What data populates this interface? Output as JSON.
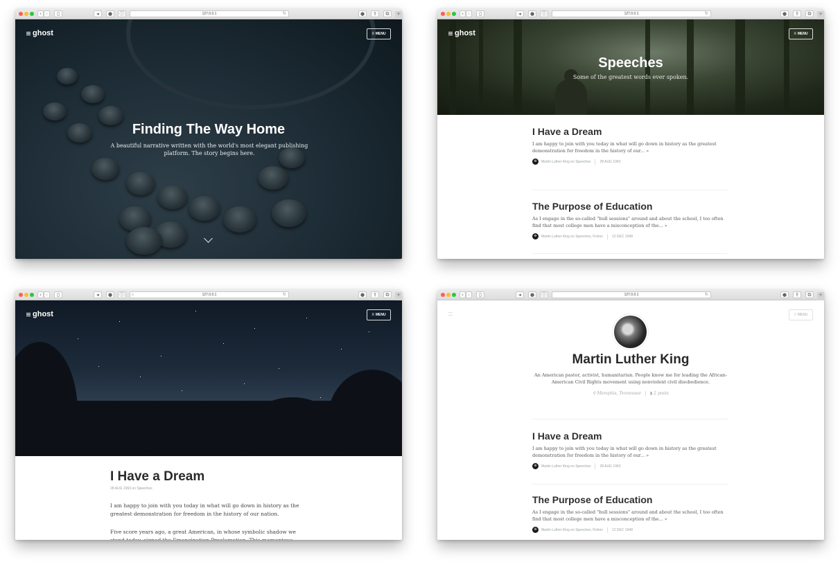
{
  "browser": {
    "address": "127.0.0.1",
    "reload_glyph": "↻",
    "back_glyph": "‹",
    "forward_glyph": "›",
    "sidebar_glyph": "▯",
    "ext1_glyph": "◂",
    "ext2_glyph": "●",
    "ext3_glyph": "ⓘ",
    "download_glyph": "●",
    "share_glyph": "⇪",
    "tabs_glyph": "⧉",
    "add_glyph": "+",
    "reader_glyph": "≡"
  },
  "blog": {
    "logo": "ghost",
    "menu_label": "MENU",
    "menu_icon": "≡"
  },
  "home": {
    "title": "Finding The Way Home",
    "subtitle": "A beautiful narrative written with the world's most elegant publishing platform. The story begins here."
  },
  "tag_page": {
    "title": "Speeches",
    "subtitle": "Some of the greatest words ever spoken."
  },
  "posts": [
    {
      "title": "I Have a Dream",
      "excerpt": "I am happy to join with you today in what will go down in history as the greatest demonstration for freedom in the history of our... »",
      "meta": "Martin Luther King on Speeches",
      "date": "28 AUG 1963"
    },
    {
      "title": "The Purpose of Education",
      "excerpt": "As I engage in the so-called \"bull sessions\" around and about the school, I too often find that most college men have a misconception of the... »",
      "meta": "Martin Luther King on Speeches, Fiction",
      "date": "12 DEC 1948"
    }
  ],
  "article": {
    "title": "I Have a Dream",
    "meta": "28 AUG 1963 on Speeches",
    "paragraph1": "I am happy to join with you today in what will go down in history as the greatest demonstration for freedom in the history of our nation.",
    "paragraph2": "Five score years ago, a great American, in whose symbolic shadow we stand today, signed the Emancipation Proclamation. This momentous decree came"
  },
  "author": {
    "name": "Martin Luther King",
    "bio": "An American pastor, activist, humanitarian. People know me for leading the African-American Civil Rights movement using nonviolent civil disobedience.",
    "location": "Memphis, Tennessee",
    "location_icon": "⚲",
    "post_count": "2 posts",
    "post_count_icon": "▮"
  }
}
